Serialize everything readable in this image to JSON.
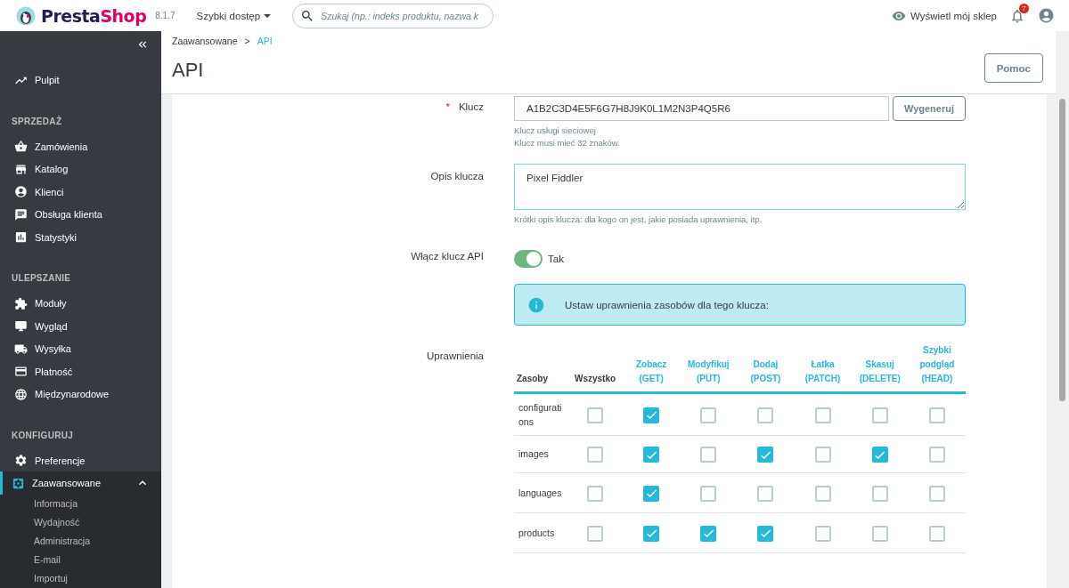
{
  "header": {
    "brand": {
      "part_1": "Presta",
      "part_2": "Shop"
    },
    "version": "8.1.7",
    "quick_access": "Szybki dostęp",
    "search": {
      "placeholder": "Szukaj (np.: indeks produktu, nazwa k"
    },
    "view_shop": "Wyświetl mój sklep",
    "notifications": "7"
  },
  "sidebar": {
    "items": [
      {
        "label": "Pulpit",
        "selected": false
      },
      {
        "section": "SPRZEDAŻ"
      },
      {
        "label": "Zamówienia",
        "selected": false
      },
      {
        "label": "Katalog",
        "selected": false
      },
      {
        "label": "Klienci",
        "selected": false
      },
      {
        "label": "Obsługa klienta",
        "selected": false
      },
      {
        "label": "Statystyki",
        "selected": false
      },
      {
        "section": "ULEPSZANIE"
      },
      {
        "label": "Moduły",
        "selected": false
      },
      {
        "label": "Wygląd",
        "selected": false
      },
      {
        "label": "Wysyłka",
        "selected": false
      },
      {
        "label": "Płatność",
        "selected": false
      },
      {
        "label": "Międzynarodowe",
        "selected": false
      },
      {
        "section": "KONFIGURUJ"
      },
      {
        "label": "Preferencje",
        "selected": false
      },
      {
        "label": "Zaawansowane",
        "selected": true,
        "expanded": true,
        "children": [
          "Informacja",
          "Wydajność",
          "Administracja",
          "E-mail",
          "Importuj"
        ]
      }
    ]
  },
  "breadcrumb": [
    "Zaawansowane",
    "API"
  ],
  "breadcrumb_separator": ">",
  "page_title": "API",
  "help_button": "Pomoc",
  "form": {
    "key": {
      "label": "Klucz",
      "required_mark": "*",
      "value": "A1B2C3D4E5F6G7H8J9K0L1M2N3P4Q5R6",
      "button": "Wygeneruj",
      "help": [
        "Klucz usługi sieciowej",
        "Klucz musi mieć 32 znaków."
      ]
    },
    "description": {
      "label": "Opis klucza",
      "value": "Pixel Fiddler",
      "help": "Krótki opis klucza: dla kogo on jest, jakie posiada uprawnienia, itp."
    },
    "enable": {
      "label": "Włącz klucz API",
      "on": true,
      "value_label": "Tak"
    },
    "info": "Ustaw uprawnienia zasobów dla tego klucza:",
    "permissions": {
      "label": "Uprawnienia",
      "columns": [
        {
          "label": "Zasoby",
          "kind": "plain"
        },
        {
          "label": "Wszystko",
          "kind": "plain"
        },
        {
          "label": "Zobacz (GET)",
          "kind": "method"
        },
        {
          "label": "Modyfikuj (PUT)",
          "kind": "method"
        },
        {
          "label": "Dodaj (POST)",
          "kind": "method"
        },
        {
          "label": "Łatka (PATCH)",
          "kind": "method"
        },
        {
          "label": "Skasuj (DELETE)",
          "kind": "method"
        },
        {
          "label": "Szybki podgląd (HEAD)",
          "kind": "method"
        }
      ],
      "rows": [
        {
          "resource": "configurations",
          "checks": [
            {
              "checked": false
            },
            {
              "checked": true
            },
            {
              "checked": false
            },
            {
              "checked": false
            },
            {
              "checked": false
            },
            {
              "checked": false
            },
            {
              "checked": false
            }
          ]
        },
        {
          "resource": "images",
          "checks": [
            {
              "checked": false
            },
            {
              "checked": true
            },
            {
              "checked": false
            },
            {
              "checked": true
            },
            {
              "checked": false
            },
            {
              "checked": true
            },
            {
              "checked": false
            }
          ]
        },
        {
          "resource": "languages",
          "checks": [
            {
              "checked": false
            },
            {
              "checked": true
            },
            {
              "checked": false
            },
            {
              "checked": false
            },
            {
              "checked": false
            },
            {
              "checked": false
            },
            {
              "checked": false
            }
          ]
        },
        {
          "resource": "products",
          "checks": [
            {
              "checked": false
            },
            {
              "checked": true
            },
            {
              "checked": true
            },
            {
              "checked": true
            },
            {
              "checked": false
            },
            {
              "checked": false
            },
            {
              "checked": false
            }
          ]
        }
      ]
    }
  }
}
